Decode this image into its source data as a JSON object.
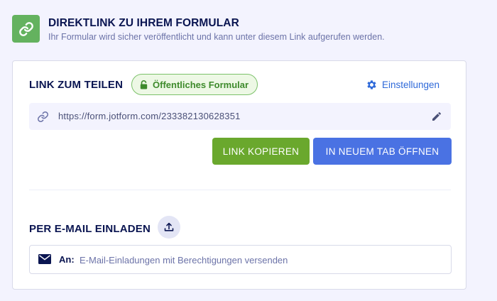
{
  "header": {
    "title": "DIREKTLINK ZU IHREM FORMULAR",
    "subtitle": "Ihr Formular wird sicher veröffentlicht und kann unter diesem Link aufgerufen werden.",
    "icon": "link-icon"
  },
  "share": {
    "title": "LINK ZUM TEILEN",
    "badge": {
      "label": "Öffentliches Formular",
      "icon": "lock-icon"
    },
    "settings": {
      "label": "Einstellungen",
      "icon": "gear-icon"
    },
    "url": "https://form.jotform.com/233382130628351",
    "buttons": {
      "copy": "LINK KOPIEREN",
      "new_tab": "IN NEUEM TAB ÖFFNEN"
    }
  },
  "email": {
    "title": "PER E-MAIL EINLADEN",
    "upload_icon": "upload-icon",
    "label": "An:",
    "placeholder": "E-Mail-Einladungen mit Berechtigungen versenden",
    "value": ""
  },
  "colors": {
    "accent_green": "#64b25f",
    "copy_button": "#6aa82d",
    "new_tab_button": "#4a72e3",
    "link_blue": "#2e69d9",
    "navy_text": "#0a1551",
    "page_background": "#f3f3fe"
  }
}
